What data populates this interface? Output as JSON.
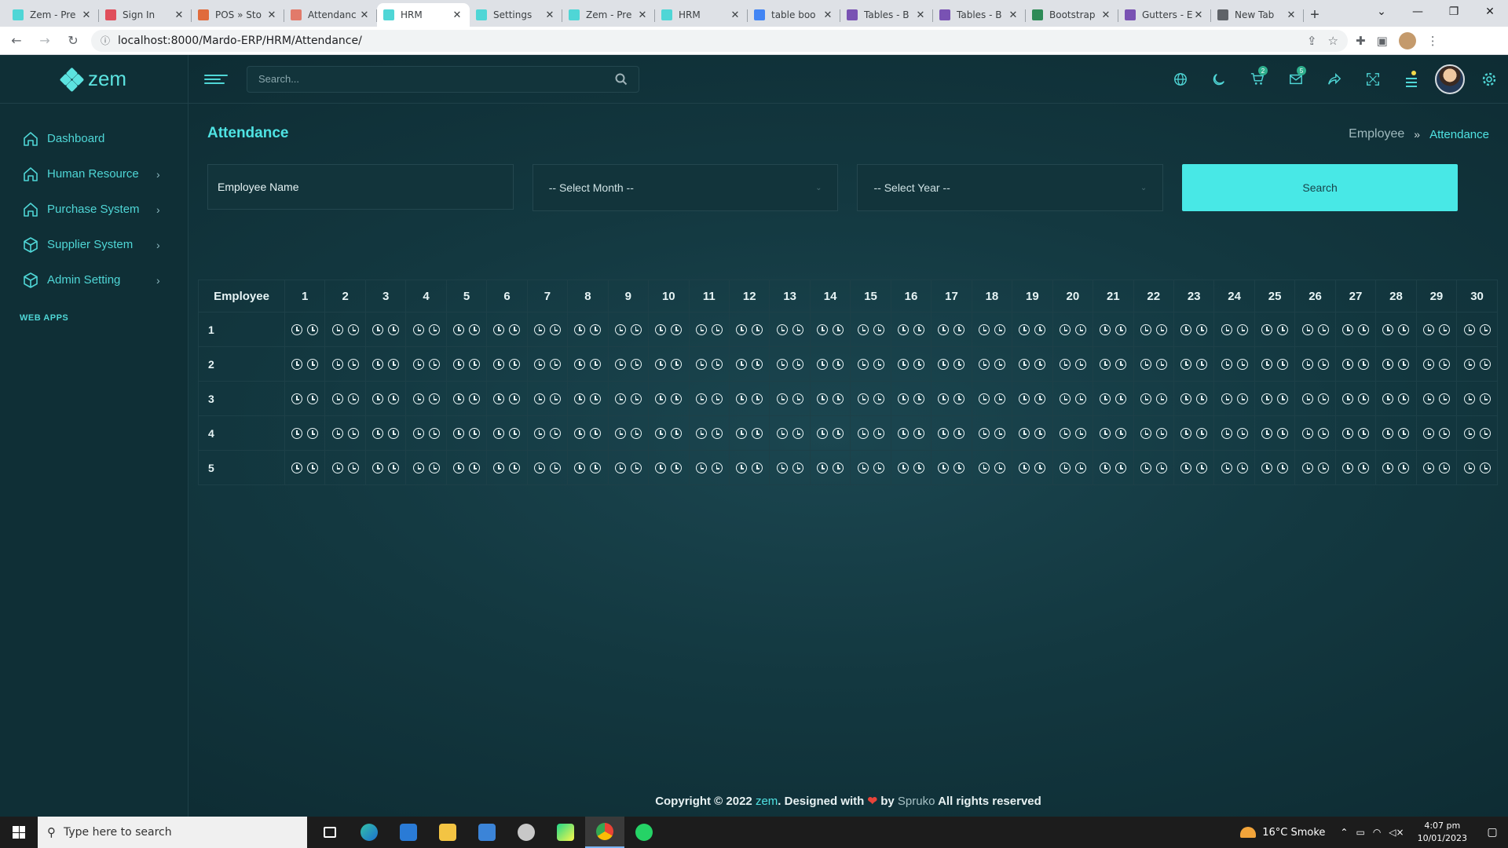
{
  "browser": {
    "tabs": [
      {
        "title": "Zem - Pre",
        "fav_color": "#4fd6d6",
        "active": false
      },
      {
        "title": "Sign In",
        "fav_color": "#e04e5b",
        "active": false
      },
      {
        "title": "POS » Sto",
        "fav_color": "#e06b3c",
        "active": false
      },
      {
        "title": "Attendanc",
        "fav_color": "#e27a6a",
        "active": false
      },
      {
        "title": "HRM",
        "fav_color": "#4fd6d6",
        "active": true
      },
      {
        "title": "Settings",
        "fav_color": "#4fd6d6",
        "active": false
      },
      {
        "title": "Zem - Pre",
        "fav_color": "#4fd6d6",
        "active": false
      },
      {
        "title": "HRM",
        "fav_color": "#4fd6d6",
        "active": false
      },
      {
        "title": "table boo",
        "fav_color": "#4285f4",
        "active": false
      },
      {
        "title": "Tables - B",
        "fav_color": "#7952b3",
        "active": false
      },
      {
        "title": "Tables - B",
        "fav_color": "#7952b3",
        "active": false
      },
      {
        "title": "Bootstrap",
        "fav_color": "#2e8b57",
        "active": false
      },
      {
        "title": "Gutters - E",
        "fav_color": "#7952b3",
        "active": false
      },
      {
        "title": "New Tab",
        "fav_color": "#5f6368",
        "active": false
      }
    ],
    "url": "localhost:8000/Mardo-ERP/HRM/Attendance/"
  },
  "app": {
    "brand": "zem",
    "accent": "#4fe3e3",
    "search_placeholder": "Search...",
    "topbar_badges": {
      "cart": "2",
      "mail": "5"
    },
    "sidebar": [
      {
        "label": "Dashboard",
        "icon": "home-icon",
        "has_children": false
      },
      {
        "label": "Human Resource",
        "icon": "home-icon",
        "has_children": true
      },
      {
        "label": "Purchase System",
        "icon": "home-icon",
        "has_children": true
      },
      {
        "label": "Supplier System",
        "icon": "box-icon",
        "has_children": true
      },
      {
        "label": "Admin Setting",
        "icon": "box-icon",
        "has_children": true
      }
    ],
    "sidebar_category": "WEB APPS"
  },
  "page": {
    "title": "Attendance",
    "breadcrumb": {
      "parent": "Employee",
      "current": "Attendance"
    },
    "filters": {
      "employee_name_value": "Employee Name",
      "month": "-- Select Month --",
      "year": "-- Select Year --",
      "search_button": "Search"
    },
    "table": {
      "first_header": "Employee",
      "days": [
        "1",
        "2",
        "3",
        "4",
        "5",
        "6",
        "7",
        "8",
        "9",
        "10",
        "11",
        "12",
        "13",
        "14",
        "15",
        "16",
        "17",
        "18",
        "19",
        "20",
        "21",
        "22",
        "23",
        "24",
        "25",
        "26",
        "27",
        "28",
        "29",
        "30"
      ],
      "rows": [
        "1",
        "2",
        "3",
        "4",
        "5"
      ],
      "icons_per_cell": 2
    },
    "footer": {
      "prefix": "Copyright © 2022",
      "brand": "zem",
      "middle": ". Designed with",
      "by": "by",
      "company": "Spruko",
      "suffix": "All rights reserved"
    }
  },
  "taskbar": {
    "search_placeholder": "Type here to search",
    "weather": "16°C  Smoke",
    "time": "4:07 pm",
    "date": "10/01/2023"
  }
}
